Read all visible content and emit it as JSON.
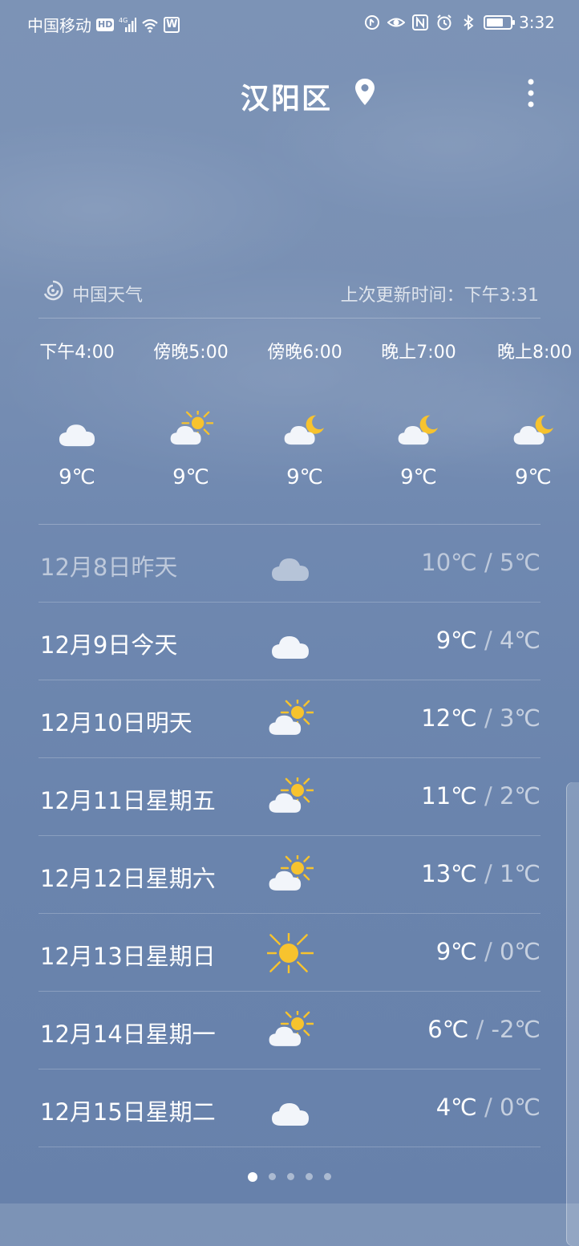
{
  "status_bar": {
    "carrier": "中国移动",
    "hd": "HD",
    "network": "4G",
    "time": "3:32",
    "battery_level": 0.7,
    "w_badge": "W"
  },
  "header": {
    "city": "汉阳区"
  },
  "source": {
    "name": "中国天气",
    "updated_label": "上次更新时间：下午3:31"
  },
  "hourly": [
    {
      "time": "下午4:00",
      "icon": "cloud-icon",
      "temp": "9℃"
    },
    {
      "time": "傍晚5:00",
      "icon": "partly-sunny-icon",
      "temp": "9℃"
    },
    {
      "time": "傍晚6:00",
      "icon": "cloud-moon-icon",
      "temp": "9℃"
    },
    {
      "time": "晚上7:00",
      "icon": "cloud-moon-icon",
      "temp": "9℃"
    },
    {
      "time": "晚上8:00",
      "icon": "cloud-moon-icon",
      "temp": "9℃"
    }
  ],
  "daily": [
    {
      "date": "12月8日昨天",
      "icon": "cloud-icon",
      "high": "10℃",
      "low": "5℃",
      "past": true
    },
    {
      "date": "12月9日今天",
      "icon": "cloud-icon",
      "high": "9℃",
      "low": "4℃",
      "past": false
    },
    {
      "date": "12月10日明天",
      "icon": "partly-sunny-icon",
      "high": "12℃",
      "low": "3℃",
      "past": false
    },
    {
      "date": "12月11日星期五",
      "icon": "partly-sunny-icon",
      "high": "11℃",
      "low": "2℃",
      "past": false
    },
    {
      "date": "12月12日星期六",
      "icon": "partly-sunny-icon",
      "high": "13℃",
      "low": "1℃",
      "past": false
    },
    {
      "date": "12月13日星期日",
      "icon": "sun-icon",
      "high": "9℃",
      "low": "0℃",
      "past": false
    },
    {
      "date": "12月14日星期一",
      "icon": "partly-sunny-icon",
      "high": "6℃",
      "low": "-2℃",
      "past": false
    },
    {
      "date": "12月15日星期二",
      "icon": "cloud-icon",
      "high": "4℃",
      "low": "0℃",
      "past": false
    }
  ],
  "temp_separator": "/",
  "pages": {
    "count": 5,
    "active": 0
  },
  "colors": {
    "sun": "#f7c32e",
    "cloud": "#f2f5fa",
    "moon": "#f7c32e"
  }
}
